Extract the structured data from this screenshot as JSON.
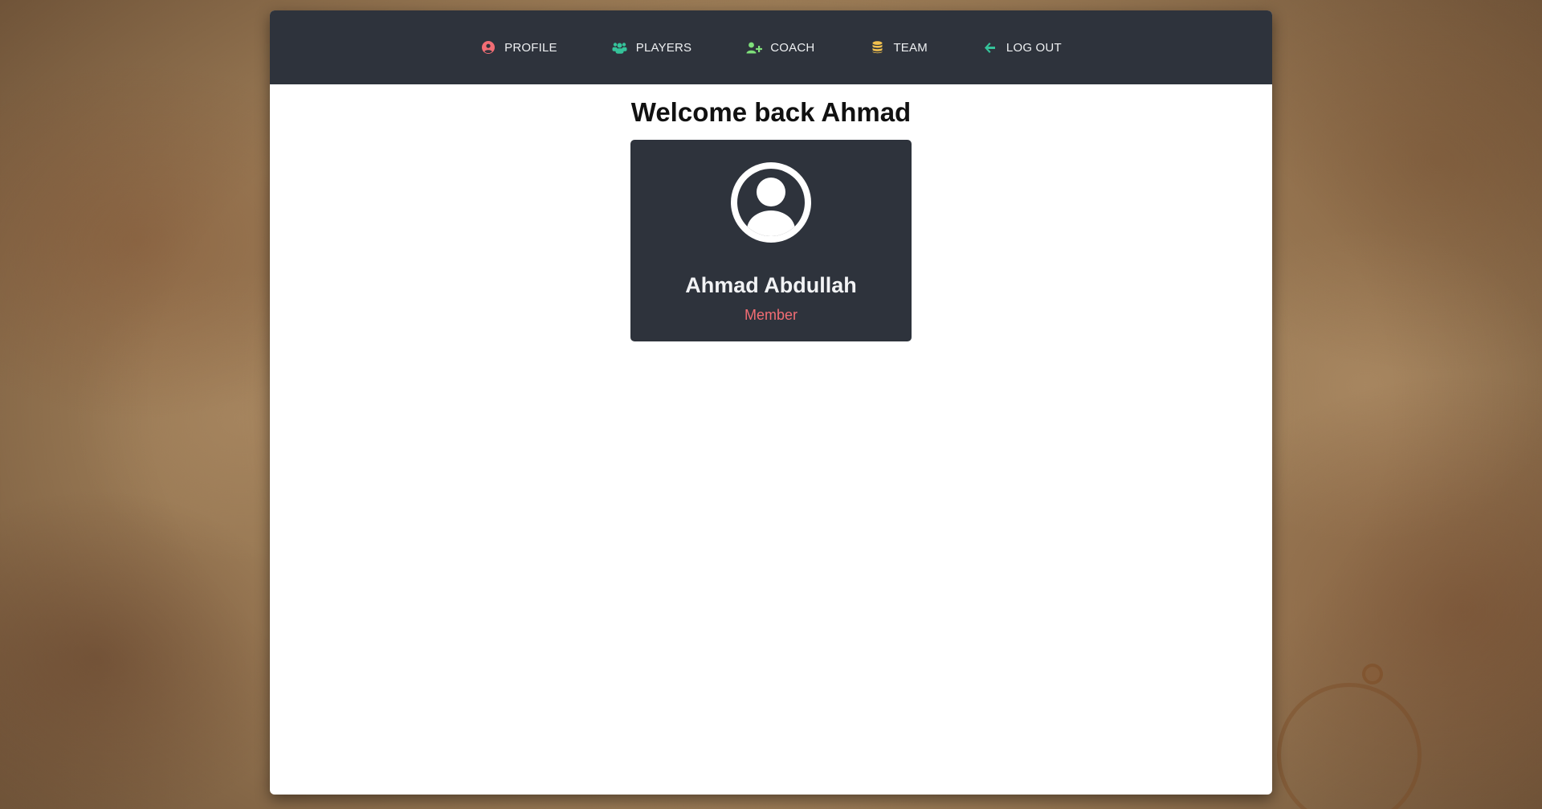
{
  "nav": {
    "items": [
      {
        "label": "PROFILE",
        "icon": "user-circle-icon",
        "icon_color": "#f26d74"
      },
      {
        "label": "PLAYERS",
        "icon": "users-icon",
        "icon_color": "#35c39a"
      },
      {
        "label": "COACH",
        "icon": "user-plus-icon",
        "icon_color": "#7fe07a"
      },
      {
        "label": "TEAM",
        "icon": "database-icon",
        "icon_color": "#f2c14e"
      },
      {
        "label": "LOG OUT",
        "icon": "arrow-left-icon",
        "icon_color": "#35c39a"
      }
    ]
  },
  "main": {
    "welcome": "Welcome back Ahmad",
    "profile": {
      "avatar_icon": "user-avatar-icon",
      "name": "Ahmad Abdullah",
      "role": "Member"
    }
  },
  "colors": {
    "navbar_bg": "#2e333c",
    "card_bg": "#2e333c",
    "role_text": "#f26d74"
  }
}
